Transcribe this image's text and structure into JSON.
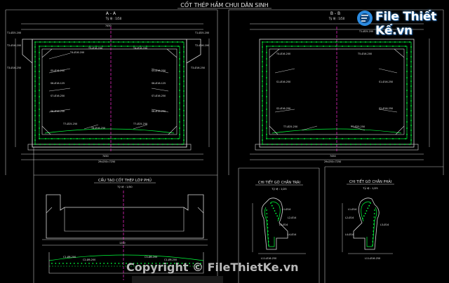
{
  "title": "CỐT THÉP HẦM CHUI DÂN SINH",
  "panels": {
    "aa": {
      "title": "A - A",
      "scale": "Tỷ lệ : 1/50"
    },
    "bb": {
      "title": "B - B",
      "scale": "Tỷ lệ : 1/50"
    },
    "cover": {
      "title": "CẤU TẠO CỐT THÉP LỚP PHỦ",
      "scale": "Tỷ lệ : 1/50"
    },
    "left_foot": {
      "title": "CHI TIẾT GỜ CHẮN TRÁI",
      "scale": "Tỷ lệ : 1/25"
    },
    "right_foot": {
      "title": "CHI TIẾT GỜ CHẮN PHẢI",
      "scale": "Tỷ lệ : 1/25"
    }
  },
  "watermark": {
    "brand": "File Thiết Kế",
    "domain": ".vn",
    "copyright": "Copyright © FileThietKe.vn"
  },
  "colors": {
    "bg": "#000000",
    "line": "#d8d8d8",
    "rebar": "#00ff3c",
    "centerline": "#ff2bd6",
    "leader": "#ffffff",
    "dim": "#cfcfcf",
    "brand_blue": "#2c8be0"
  }
}
